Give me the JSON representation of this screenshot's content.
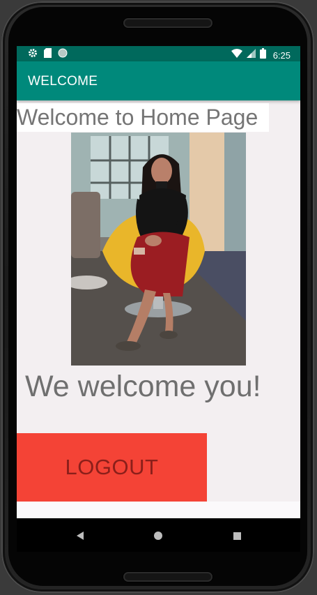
{
  "status_bar": {
    "time": "6:25",
    "left_icons": [
      "gear-icon",
      "sd-card-icon",
      "circle-icon"
    ],
    "right_icons": [
      "wifi-icon",
      "signal-icon",
      "battery-icon"
    ],
    "color": "#00695c"
  },
  "app_bar": {
    "title": "WELCOME",
    "color": "#00897b"
  },
  "main": {
    "heading": "Welcome to Home Page",
    "photo_icon": "person-photo",
    "message": "We welcome you!",
    "logout_label": "LOGOUT",
    "logout_color": "#f44336"
  },
  "nav_bar": {
    "icons": [
      "back-icon",
      "home-icon",
      "recents-icon"
    ]
  }
}
